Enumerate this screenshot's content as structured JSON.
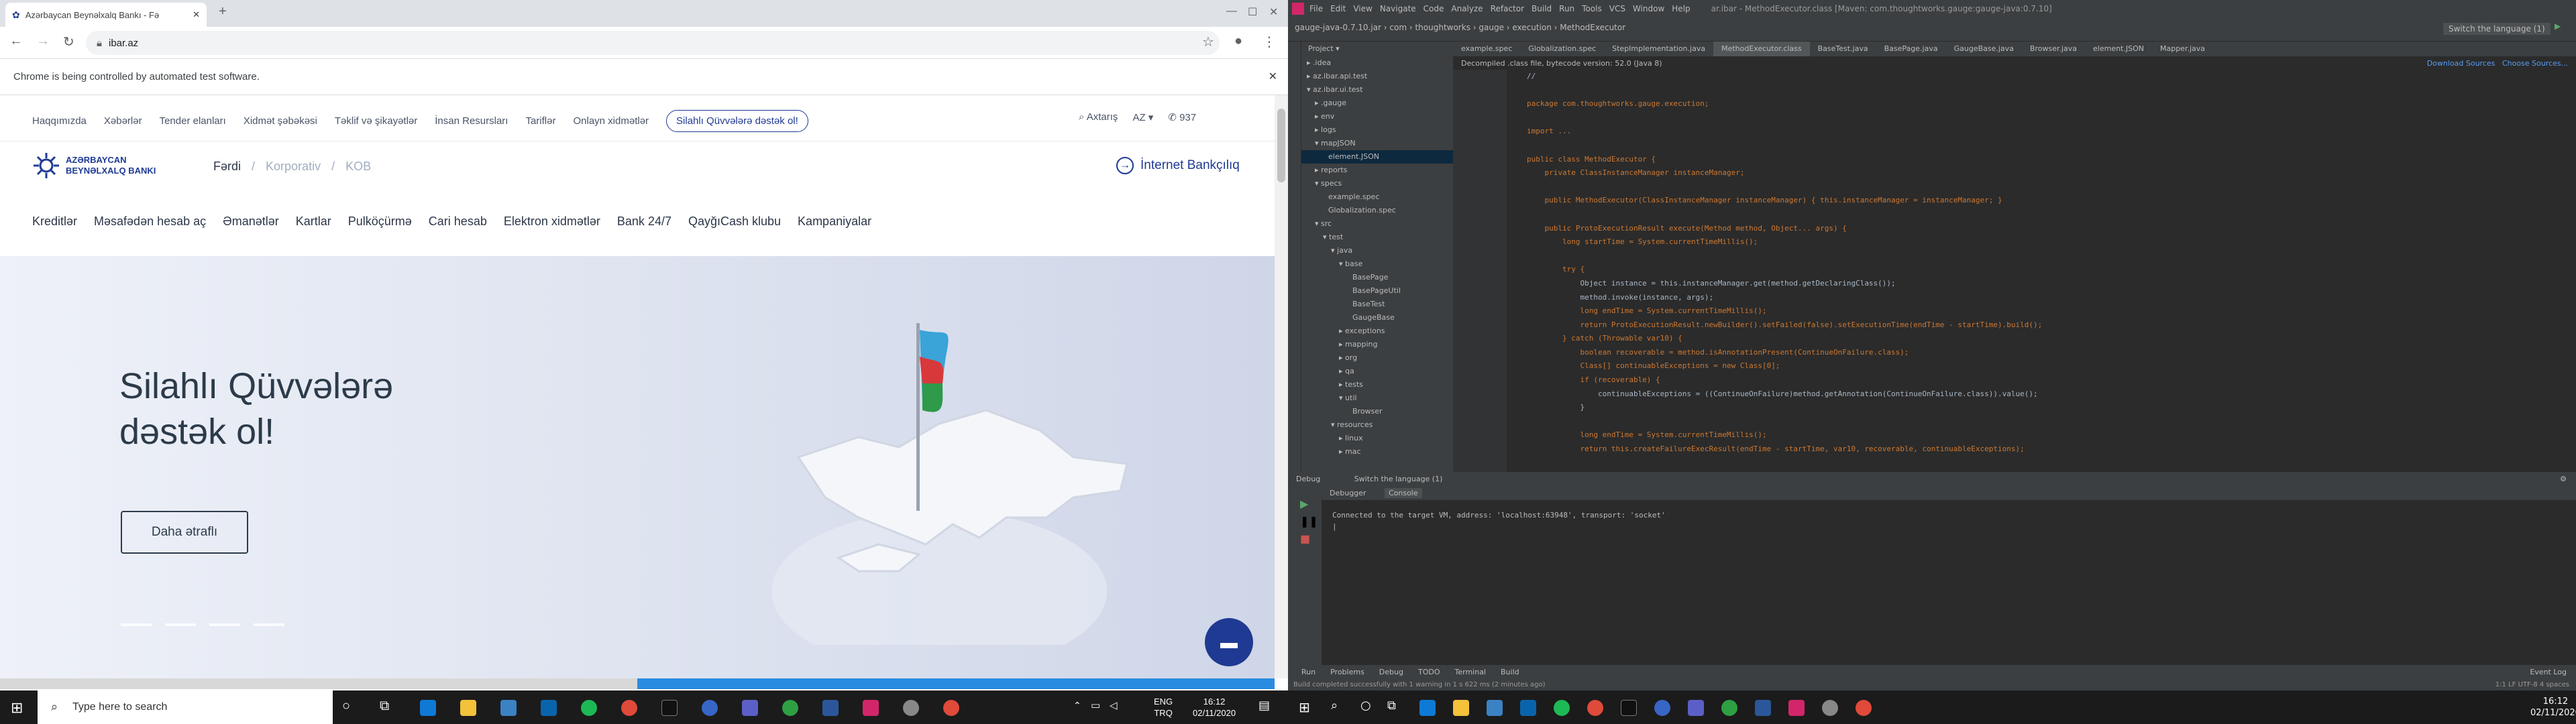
{
  "browser": {
    "tab_title": "Azərbaycan Beynəlxalq Bankı - Fə",
    "url": "ibar.az",
    "infobar_text": "Chrome is being controlled by automated test software."
  },
  "site": {
    "top_links": [
      "Haqqımızda",
      "Xəbərlər",
      "Tender elanları",
      "Xidmət şəbəkəsi",
      "Təklif və şikayətlər",
      "İnsan Resursları",
      "Tariflər",
      "Onlayn xidmətlər"
    ],
    "campaign_pill": "Silahlı Qüvvələrə dəstək ol!",
    "search_label": "Axtarış",
    "lang": "AZ",
    "phone": "937",
    "logo_line1": "AZƏRBAYCAN",
    "logo_line2": "BEYNƏLXALQ BANKI",
    "segments": [
      "Fərdi",
      "Korporativ",
      "KOB"
    ],
    "internet_banking": "İnternet Bankçılıq",
    "main_nav": [
      "Kreditlər",
      "Məsafədən hesab aç",
      "Əmanətlər",
      "Kartlar",
      "Pulköçürmə",
      "Cari hesab",
      "Elektron xidmətlər",
      "Bank 24/7",
      "QayğıCash klubu",
      "Kampaniyalar"
    ],
    "hero_title_1": "Silahlı Qüvvələrə",
    "hero_title_2": "dəstək ol!",
    "hero_button": "Daha ətraflı"
  },
  "taskbar": {
    "search_placeholder": "Type here to search",
    "lang1": "ENG",
    "lang2": "TRQ",
    "time": "16:12",
    "date": "02/11/2020"
  },
  "ide": {
    "menu": [
      "File",
      "Edit",
      "View",
      "Navigate",
      "Code",
      "Analyze",
      "Refactor",
      "Build",
      "Run",
      "Tools",
      "VCS",
      "Window",
      "Help"
    ],
    "title": "ar.ibar - MethodExecutor.class [Maven: com.thoughtworks.gauge:gauge-java:0.7.10]",
    "breadcrumb": "gauge-java-0.7.10.jar  ›  com  ›  thoughtworks  ›  gauge  ›  execution  ›  MethodExecutor",
    "run_config": "Switch the language (1)",
    "project_label": "Project",
    "file_tabs": [
      "example.spec",
      "Globalization.spec",
      "StepImplementation.java",
      "MethodExecutor.class",
      "BaseTest.java",
      "BasePage.java",
      "GaugeBase.java",
      "Browser.java",
      "element.JSON",
      "Mapper.java"
    ],
    "decompiled_note": "Decompiled .class file, bytecode version: 52.0 (Java 8)",
    "download_sources": "Download Sources",
    "choose_sources": "Choose Sources...",
    "tree": [
      ".idea",
      "az.ibar.api.test",
      "az.ibar.ui.test",
      ".gauge",
      "env",
      "logs",
      "mapJSON",
      "element.JSON",
      "reports",
      "specs",
      "example.spec",
      "Globalization.spec",
      "src",
      "test",
      "java",
      "base",
      "BasePage",
      "BasePageUtil",
      "BaseTest",
      "GaugeBase",
      "exceptions",
      "mapping",
      "org",
      "qa",
      "tests",
      "util",
      "Browser",
      "resources",
      "linux",
      "mac"
    ],
    "code_lines": [
      "//",
      "",
      "package com.thoughtworks.gauge.execution;",
      "",
      "import ...",
      "",
      "public class MethodExecutor {",
      "    private ClassInstanceManager instanceManager;",
      "",
      "    public MethodExecutor(ClassInstanceManager instanceManager) { this.instanceManager = instanceManager; }",
      "",
      "    public ProtoExecutionResult execute(Method method, Object... args) {",
      "        long startTime = System.currentTimeMillis();",
      "",
      "        try {",
      "            Object instance = this.instanceManager.get(method.getDeclaringClass());",
      "            method.invoke(instance, args);",
      "            long endTime = System.currentTimeMillis();",
      "            return ProtoExecutionResult.newBuilder().setFailed(false).setExecutionTime(endTime - startTime).build();",
      "        } catch (Throwable var10) {",
      "            boolean recoverable = method.isAnnotationPresent(ContinueOnFailure.class);",
      "            Class[] continuableExceptions = new Class[0];",
      "            if (recoverable) {",
      "                continuableExceptions = ((ContinueOnFailure)method.getAnnotation(ContinueOnFailure.class)).value();",
      "            }",
      "",
      "            long endTime = System.currentTimeMillis();",
      "            return this.createFailureExecResult(endTime - startTime, var10, recoverable, continuableExceptions);"
    ],
    "debug_label": "Debug",
    "debug_config": "Switch the language (1)",
    "debugger_tab": "Debugger",
    "console_tab": "Console",
    "console_text": "Connected to the target VM, address: 'localhost:63948', transport: 'socket'",
    "bottom_tools": [
      "Run",
      "Problems",
      "Debug",
      "TODO",
      "Terminal",
      "Build"
    ],
    "event_log": "Event Log",
    "status_text": "Build completed successfully with 1 warning in 1 s 622 ms (2 minutes ago)",
    "status_right": "1:1  LF  UTF-8  4 spaces",
    "time": "16:12",
    "date": "02/11/2020"
  }
}
